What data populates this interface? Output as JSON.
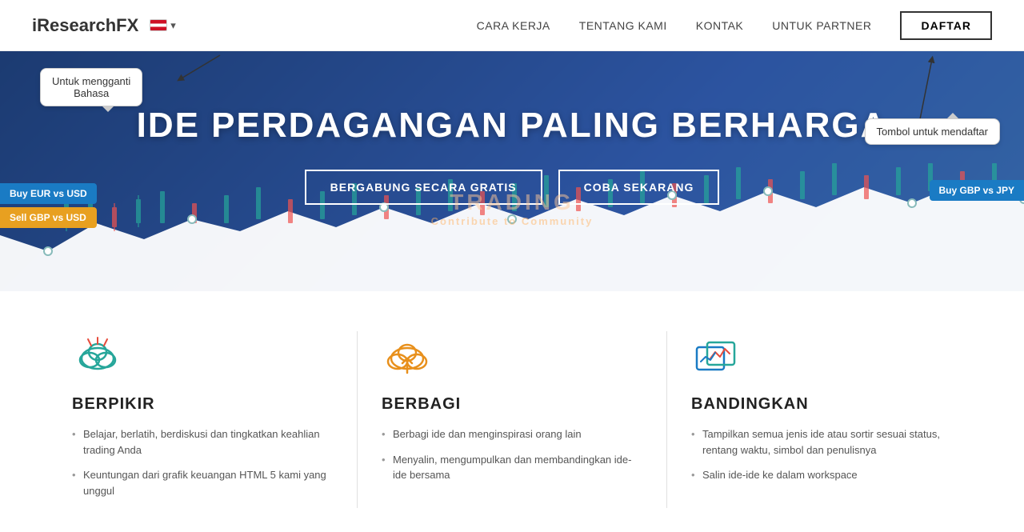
{
  "brand": {
    "name": "iResearchFX"
  },
  "flag": {
    "label": "▾"
  },
  "nav": {
    "links": [
      {
        "id": "cara-kerja",
        "label": "CARA KERJA"
      },
      {
        "id": "tentang-kami",
        "label": "TENTANG KAMI"
      },
      {
        "id": "kontak",
        "label": "KONTAK"
      },
      {
        "id": "untuk-partner",
        "label": "UNTUK PARTNER"
      }
    ],
    "daftar": "DAFTAR"
  },
  "callouts": {
    "bahasa": "Untuk mengganti\nBahasa",
    "daftar": "Tombol untuk mendaftar"
  },
  "hero": {
    "title": "IDE PERDAGANGAN PALING BERHARGA",
    "btn_bergabung": "BERGABUNG SECARA GRATIS",
    "btn_coba": "COBA SEKARANG",
    "badge_sell": "Sell GBP vs USD",
    "badge_buy_left": "Buy EUR vs USD",
    "badge_buy_right": "Buy GBP vs JPY"
  },
  "watermark": {
    "line1": "TRADING",
    "line2": "Contribute to Community"
  },
  "features": [
    {
      "id": "berpikir",
      "icon": "brain-cloud",
      "title": "BERPIKIR",
      "items": [
        "Belajar, berlatih, berdiskusi dan tingkatkan keahlian trading Anda",
        "Keuntungan dari grafik keuangan HTML 5 kami yang unggul"
      ]
    },
    {
      "id": "berbagi",
      "icon": "cloud-upload",
      "title": "BERBAGI",
      "items": [
        "Berbagi ide dan menginspirasi orang lain",
        "Menyalin, mengumpulkan dan membandingkan ide-ide bersama"
      ]
    },
    {
      "id": "bandingkan",
      "icon": "compare-chart",
      "title": "BANDINGKAN",
      "items": [
        "Tampilkan semua jenis ide atau sortir sesuai status, rentang waktu, simbol dan penulisnya",
        "Salin ide-ide ke dalam workspace"
      ]
    }
  ]
}
